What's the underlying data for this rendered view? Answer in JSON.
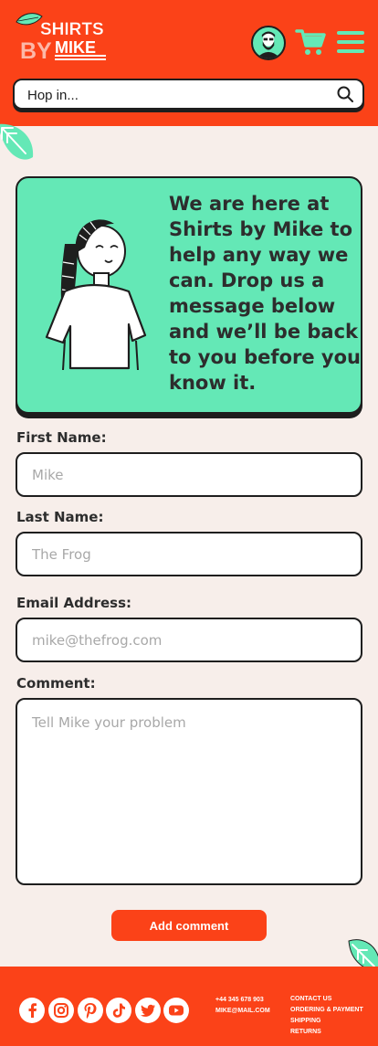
{
  "header": {
    "logo": {
      "line1": "SHIRTS",
      "line2": "BY",
      "line3": "MIKE"
    },
    "search": {
      "placeholder": "Hop in..."
    }
  },
  "hero": {
    "message": "We are here at Shirts by Mike to help any way we can. Drop us a message below and we’ll be back to you before you know it."
  },
  "form": {
    "first_name": {
      "label": "First Name:",
      "placeholder": "Mike"
    },
    "last_name": {
      "label": "Last Name:",
      "placeholder": "The Frog"
    },
    "email": {
      "label": "Email Address:",
      "placeholder": "mike@thefrog.com"
    },
    "comment": {
      "label": "Comment:",
      "placeholder": "Tell Mike your problem"
    },
    "submit_label": "Add comment"
  },
  "footer": {
    "social": [
      {
        "icon": "facebook-icon"
      },
      {
        "icon": "instagram-icon"
      },
      {
        "icon": "pinterest-icon"
      },
      {
        "icon": "tiktok-icon"
      },
      {
        "icon": "twitter-icon"
      },
      {
        "icon": "youtube-icon"
      }
    ],
    "phone": "+44 345 678 903",
    "email": "MIKE@MAIL.COM",
    "links": [
      "CONTACT US",
      "ORDERING & PAYMENT",
      "SHIPPING",
      "RETURNS"
    ]
  },
  "colors": {
    "brand": "#fb4218",
    "accent": "#64e8b6",
    "background": "#f7eeea",
    "ink": "#1e1e1e"
  }
}
